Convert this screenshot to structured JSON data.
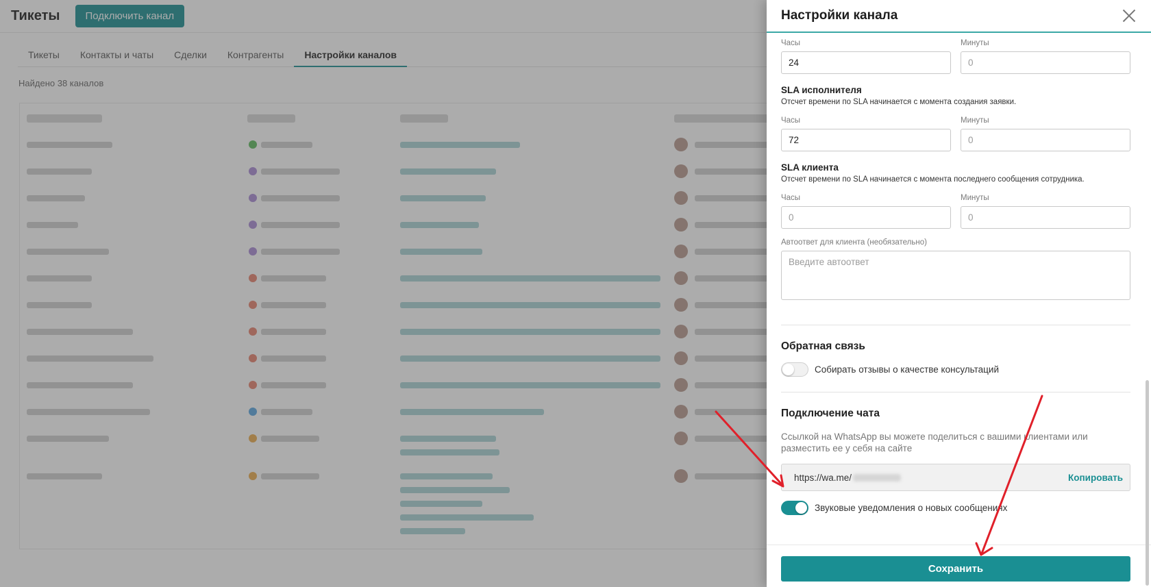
{
  "app": {
    "title": "Тикеты",
    "connect_button": "Подключить канал"
  },
  "tabs": [
    {
      "label": "Тикеты"
    },
    {
      "label": "Контакты и чаты"
    },
    {
      "label": "Сделки"
    },
    {
      "label": "Контрагенты"
    },
    {
      "label": "Настройки каналов",
      "active": true
    }
  ],
  "found_text": "Найдено 38 каналов",
  "drawer": {
    "title": "Настройки канала",
    "top_fields": {
      "hours_label": "Часы",
      "hours_value": "24",
      "minutes_label": "Минуты",
      "minutes_placeholder": "0"
    },
    "sla_executor": {
      "title": "SLA исполнителя",
      "note": "Отсчет времени по SLA начинается с момента создания заявки.",
      "hours_label": "Часы",
      "hours_value": "72",
      "minutes_label": "Минуты",
      "minutes_value": "0"
    },
    "sla_client": {
      "title": "SLA клиента",
      "note": "Отсчет времени по SLA начинается с момента последнего сообщения сотрудника.",
      "hours_label": "Часы",
      "hours_placeholder": "0",
      "minutes_label": "Минуты",
      "minutes_placeholder": "0"
    },
    "autoreply": {
      "label": "Автоответ для клиента (необязательно)",
      "placeholder": "Введите автоответ"
    },
    "feedback": {
      "title": "Обратная связь",
      "toggle_label": "Собирать отзывы о качестве консультаций",
      "toggle_on": false
    },
    "chat_connect": {
      "title": "Подключение чата",
      "help": "Ссылкой на WhatsApp вы можете поделиться с вашими клиентами или разместить ее у себя на сайте",
      "link": "https://wa.me/",
      "copy_label": "Копировать",
      "sound_label": "Звуковые уведомления о новых сообщениях",
      "sound_on": true
    },
    "save_label": "Сохранить"
  },
  "colors": {
    "accent": "#1a8f93",
    "arrow": "#e0202a"
  }
}
